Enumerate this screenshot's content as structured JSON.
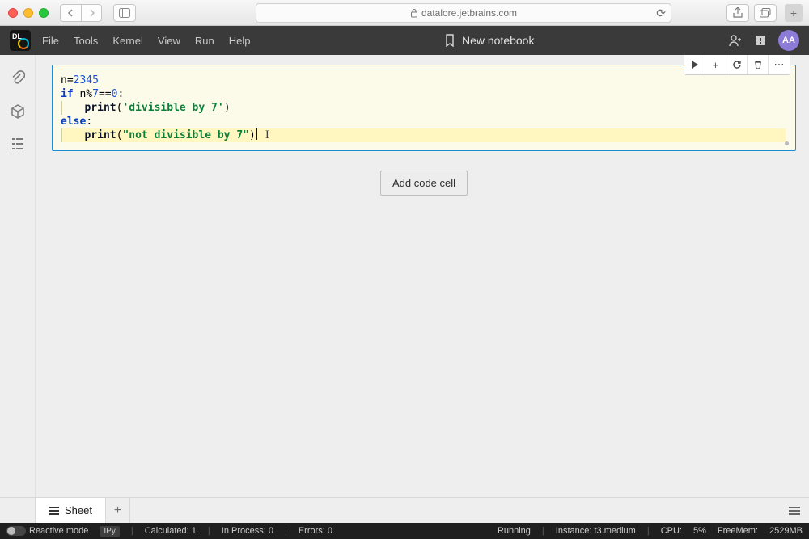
{
  "browser": {
    "url_host": "datalore.jetbrains.com"
  },
  "menubar": {
    "items": [
      "File",
      "Tools",
      "Kernel",
      "View",
      "Run",
      "Help"
    ],
    "title": "New notebook",
    "avatar": "AA"
  },
  "cell": {
    "toolbar": {
      "run_title": "Run cell",
      "add_title": "Add cell",
      "restart_title": "Restart",
      "delete_title": "Delete cell",
      "more_title": "More"
    },
    "code": {
      "l1_a": "n=",
      "l1_num": "2345",
      "l2_a": "if",
      "l2_b": " n%",
      "l2_c": "7",
      "l2_d": "==",
      "l2_e": "0",
      "l2_f": ":",
      "l3_fn": "print",
      "l3_open": "(",
      "l3_str": "'divisible by 7'",
      "l3_close": ")",
      "l4_a": "else",
      "l4_b": ":",
      "l5_fn": "print",
      "l5_open": "(",
      "l5_str": "\"not divisible by 7\"",
      "l5_close": ")"
    }
  },
  "add_cell_label": "Add code cell",
  "sheet_tab": "Sheet",
  "status": {
    "reactive": "Reactive mode",
    "ipy": "IPy",
    "calculated": "Calculated: 1",
    "inprocess": "In Process: 0",
    "errors": "Errors: 0",
    "running": "Running",
    "instance": "Instance: t3.medium",
    "cpu": "CPU:",
    "cpu_val": "5%",
    "freemem": "FreeMem:",
    "freemem_val": "2529MB"
  }
}
